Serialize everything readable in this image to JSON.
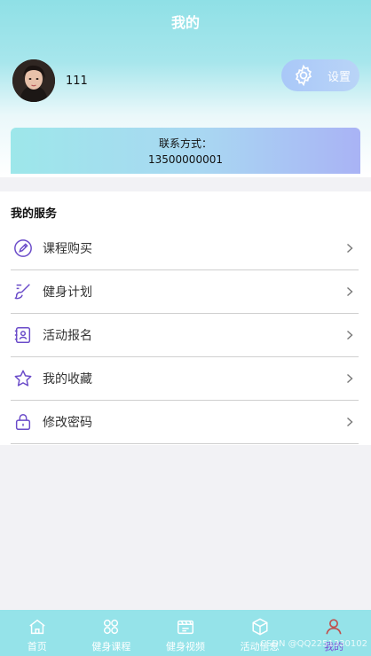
{
  "header": {
    "title": "我的"
  },
  "profile": {
    "username": "111",
    "settings_label": "设置"
  },
  "contact": {
    "label": "联系方式：",
    "phone": "13500000001"
  },
  "services": {
    "title": "我的服务",
    "items": [
      {
        "label": "课程购买",
        "icon": "pencil-circle-icon"
      },
      {
        "label": "健身计划",
        "icon": "brush-icon"
      },
      {
        "label": "活动报名",
        "icon": "contact-book-icon"
      },
      {
        "label": "我的收藏",
        "icon": "star-icon"
      },
      {
        "label": "修改密码",
        "icon": "lock-icon"
      }
    ]
  },
  "tabbar": {
    "tabs": [
      {
        "label": "首页",
        "icon": "home-icon"
      },
      {
        "label": "健身课程",
        "icon": "grid-icon"
      },
      {
        "label": "健身视频",
        "icon": "video-icon"
      },
      {
        "label": "活动信息",
        "icon": "cube-icon"
      },
      {
        "label": "我的",
        "icon": "user-icon"
      }
    ],
    "active_index": 4
  },
  "watermark": "CSDN @QQ2251330102",
  "colors": {
    "accent": "#7b4bd6",
    "tabbar_bg": "#95e3e9",
    "header_bg": "#8fe0e6"
  }
}
